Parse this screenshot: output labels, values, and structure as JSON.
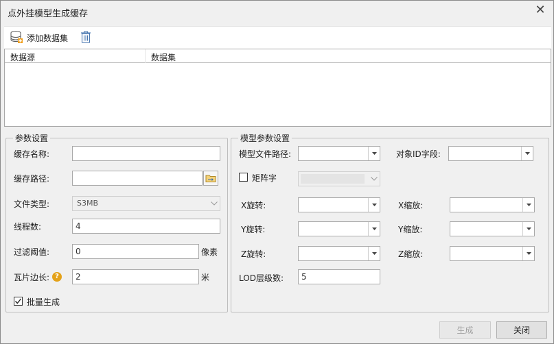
{
  "window": {
    "title": "点外挂模型生成缓存"
  },
  "toolbar": {
    "add_dataset_label": "添加数据集"
  },
  "grid": {
    "columns": [
      "数据源",
      "数据集"
    ]
  },
  "params": {
    "title": "参数设置",
    "cache_name_label": "缓存名称:",
    "cache_name_value": "",
    "cache_path_label": "缓存路径:",
    "cache_path_value": "",
    "file_type_label": "文件类型:",
    "file_type_value": "S3MB",
    "thread_count_label": "线程数:",
    "thread_count_value": "4",
    "filter_threshold_label": "过滤阈值:",
    "filter_threshold_value": "0",
    "filter_threshold_unit": "像素",
    "tile_side_label": "瓦片边长:",
    "tile_side_value": "2",
    "tile_side_unit": "米",
    "batch_label": "批量生成",
    "batch_checked": true
  },
  "model_params": {
    "title": "模型参数设置",
    "model_path_label": "模型文件路径:",
    "object_id_label": "对象ID字段:",
    "matrix_label": "矩阵字",
    "matrix_checked": false,
    "x_rotate_label": "X旋转:",
    "y_rotate_label": "Y旋转:",
    "z_rotate_label": "Z旋转:",
    "x_scale_label": "X缩放:",
    "y_scale_label": "Y缩放:",
    "z_scale_label": "Z缩放:",
    "lod_label": "LOD层级数:",
    "lod_value": "5"
  },
  "footer": {
    "generate_label": "生成",
    "close_label": "关闭"
  }
}
